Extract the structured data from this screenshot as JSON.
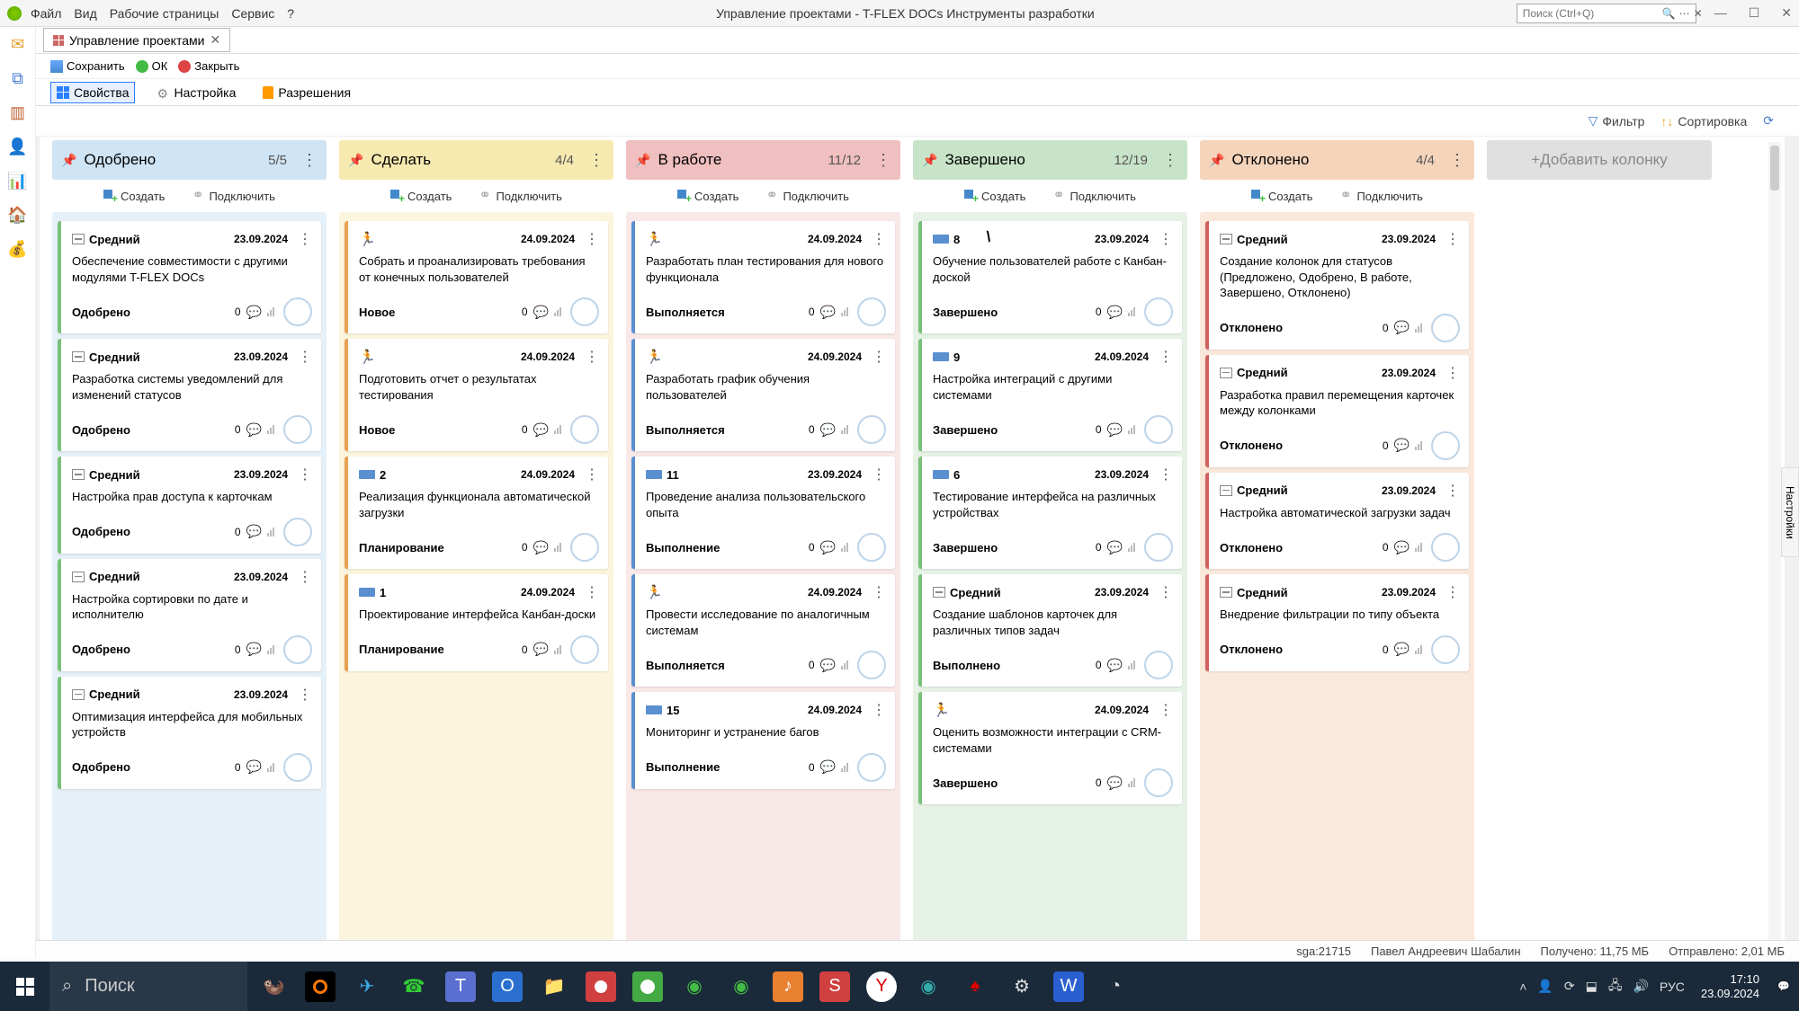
{
  "titlebar": {
    "menu": [
      "Файл",
      "Вид",
      "Рабочие страницы",
      "Сервис",
      "?"
    ],
    "title": "Управление проектами - T-FLEX DOCs Инструменты разработки",
    "search_placeholder": "Поиск (Ctrl+Q)"
  },
  "tab": {
    "label": "Управление проектами"
  },
  "toolbar": {
    "save": "Сохранить",
    "ok": "ОК",
    "close": "Закрыть"
  },
  "subtabs": {
    "props": "Свойства",
    "settings": "Настройка",
    "perms": "Разрешения"
  },
  "filter": {
    "filter": "Фильтр",
    "sort": "Сортировка"
  },
  "col_actions": {
    "create": "Создать",
    "connect": "Подключить"
  },
  "add_column": "+Добавить колонку",
  "right_tab": "Настройки",
  "columns": [
    {
      "title": "Одобрено",
      "count": "5/5",
      "color": "blue",
      "body": "blue-bg",
      "cards": [
        {
          "bl": "bl-green",
          "ptype": "mid",
          "priority": "Средний",
          "date": "23.09.2024",
          "title": "Обеспечение совместимости с другими модулями T-FLEX DOCs",
          "status": "Одобрено",
          "num": "0"
        },
        {
          "bl": "bl-green",
          "ptype": "mid",
          "priority": "Средний",
          "date": "23.09.2024",
          "title": "Разработка системы уведомлений для изменений статусов",
          "status": "Одобрено",
          "num": "0"
        },
        {
          "bl": "bl-green",
          "ptype": "mid",
          "priority": "Средний",
          "date": "23.09.2024",
          "title": "Настройка прав доступа к карточкам",
          "status": "Одобрено",
          "num": "0"
        },
        {
          "bl": "bl-green",
          "ptype": "mid",
          "priority": "Средний",
          "date": "23.09.2024",
          "title": "Настройка сортировки по дате и исполнителю",
          "status": "Одобрено",
          "num": "0"
        },
        {
          "bl": "bl-green",
          "ptype": "mid",
          "priority": "Средний",
          "date": "23.09.2024",
          "title": "Оптимизация интерфейса для мобильных устройств",
          "status": "Одобрено",
          "num": "0"
        }
      ]
    },
    {
      "title": "Сделать",
      "count": "4/4",
      "color": "yellow",
      "body": "yellow-bg",
      "cards": [
        {
          "bl": "bl-orange",
          "ptype": "run",
          "priority": "",
          "date": "24.09.2024",
          "title": "Собрать и проанализировать требования от конечных пользователей",
          "status": "Новое",
          "num": "0"
        },
        {
          "bl": "bl-orange",
          "ptype": "run",
          "priority": "",
          "date": "24.09.2024",
          "title": "Подготовить отчет о результатах тестирования",
          "status": "Новое",
          "num": "0"
        },
        {
          "bl": "bl-orange",
          "ptype": "tag",
          "priority": "2",
          "date": "24.09.2024",
          "title": "Реализация функционала автоматической загрузки",
          "status": "Планирование",
          "num": "0"
        },
        {
          "bl": "bl-orange",
          "ptype": "tag",
          "priority": "1",
          "date": "24.09.2024",
          "title": "Проектирование интерфейса Канбан-доски",
          "status": "Планирование",
          "num": "0"
        }
      ]
    },
    {
      "title": "В работе",
      "count": "11/12",
      "color": "red",
      "body": "red-bg",
      "cards": [
        {
          "bl": "bl-blue",
          "ptype": "run",
          "priority": "",
          "date": "24.09.2024",
          "title": "Разработать план тестирования для нового функционала",
          "status": "Выполняется",
          "num": "0"
        },
        {
          "bl": "bl-blue",
          "ptype": "run",
          "priority": "",
          "date": "24.09.2024",
          "title": "Разработать график обучения пользователей",
          "status": "Выполняется",
          "num": "0"
        },
        {
          "bl": "bl-blue",
          "ptype": "tag",
          "priority": "11",
          "date": "23.09.2024",
          "title": "Проведение анализа пользовательского опыта",
          "status": "Выполнение",
          "num": "0"
        },
        {
          "bl": "bl-blue",
          "ptype": "run",
          "priority": "",
          "date": "24.09.2024",
          "title": "Провести исследование по аналогичным системам",
          "status": "Выполняется",
          "num": "0"
        },
        {
          "bl": "bl-blue",
          "ptype": "tag",
          "priority": "15",
          "date": "24.09.2024",
          "title": "Мониторинг и устранение багов",
          "status": "Выполнение",
          "num": "0"
        }
      ]
    },
    {
      "title": "Завершено",
      "count": "12/19",
      "color": "green",
      "body": "green-bg",
      "cards": [
        {
          "bl": "bl-green",
          "ptype": "tag",
          "priority": "8",
          "date": "23.09.2024",
          "title": "Обучение пользователей работе с Канбан-доской",
          "status": "Завершено",
          "num": "0"
        },
        {
          "bl": "bl-green",
          "ptype": "tag",
          "priority": "9",
          "date": "24.09.2024",
          "title": "Настройка интеграций с другими системами",
          "status": "Завершено",
          "num": "0"
        },
        {
          "bl": "bl-green",
          "ptype": "tag",
          "priority": "6",
          "date": "23.09.2024",
          "title": "Тестирование интерфейса на различных устройствах",
          "status": "Завершено",
          "num": "0"
        },
        {
          "bl": "bl-green",
          "ptype": "mid",
          "priority": "Средний",
          "date": "23.09.2024",
          "title": "Создание шаблонов карточек для различных типов задач",
          "status": "Выполнено",
          "num": "0"
        },
        {
          "bl": "bl-green",
          "ptype": "run",
          "priority": "",
          "date": "24.09.2024",
          "title": "Оценить возможности интеграции с CRM-системами",
          "status": "Завершено",
          "num": "0"
        }
      ]
    },
    {
      "title": "Отклонено",
      "count": "4/4",
      "color": "orange",
      "body": "orange-bg",
      "cards": [
        {
          "bl": "bl-red",
          "ptype": "mid",
          "priority": "Средний",
          "date": "23.09.2024",
          "title": "Создание колонок для статусов (Предложено, Одобрено, В работе, Завершено, Отклонено)",
          "status": "Отклонено",
          "num": "0"
        },
        {
          "bl": "bl-red",
          "ptype": "mid",
          "priority": "Средний",
          "date": "23.09.2024",
          "title": "Разработка правил перемещения карточек между колонками",
          "status": "Отклонено",
          "num": "0"
        },
        {
          "bl": "bl-red",
          "ptype": "mid",
          "priority": "Средний",
          "date": "23.09.2024",
          "title": "Настройка автоматической загрузки задач",
          "status": "Отклонено",
          "num": "0"
        },
        {
          "bl": "bl-red",
          "ptype": "mid",
          "priority": "Средний",
          "date": "23.09.2024",
          "title": "Внедрение фильтрации по типу объекта",
          "status": "Отклонено",
          "num": "0"
        }
      ]
    }
  ],
  "statusbar": {
    "sga": "sga:21715",
    "user": "Павел Андреевич Шабалин",
    "received": "Получено: 11,75 МБ",
    "sent": "Отправлено: 2,01 МБ"
  },
  "taskbar": {
    "search": "Поиск",
    "lang": "РУС",
    "time": "17:10",
    "date": "23.09.2024"
  }
}
